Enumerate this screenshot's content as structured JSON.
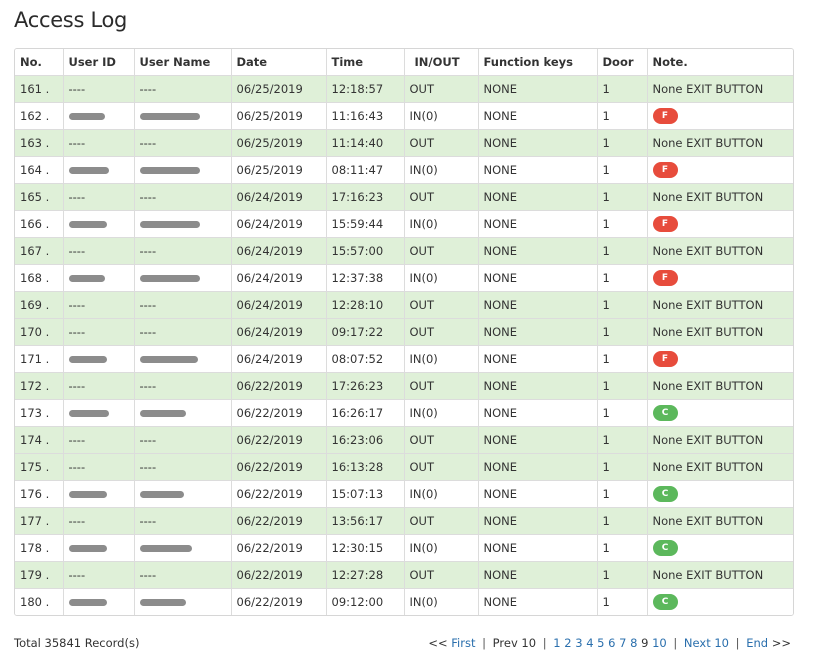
{
  "page": {
    "title": "Access Log"
  },
  "colors": {
    "exit_row_bg": "#dff0d8",
    "badge_f": "#e74c3c",
    "badge_c": "#5cb85c",
    "link": "#2a6fad"
  },
  "table": {
    "columns": [
      "No.",
      "User ID",
      "User Name",
      "Date",
      "Time",
      "IN/OUT",
      "Function keys",
      "Door",
      "Note."
    ],
    "rows": [
      {
        "no": "161 .",
        "user_id": "----",
        "user_name": "----",
        "date": "06/25/2019",
        "time": "12:18:57",
        "inout": "OUT",
        "fkey": "NONE",
        "door": "1",
        "note": "None EXIT BUTTON",
        "badge": ""
      },
      {
        "no": "162 .",
        "user_id": "",
        "user_name": "",
        "date": "06/25/2019",
        "time": "11:16:43",
        "inout": "IN(0)",
        "fkey": "NONE",
        "door": "1",
        "note": "",
        "badge": "F"
      },
      {
        "no": "163 .",
        "user_id": "----",
        "user_name": "----",
        "date": "06/25/2019",
        "time": "11:14:40",
        "inout": "OUT",
        "fkey": "NONE",
        "door": "1",
        "note": "None EXIT BUTTON",
        "badge": ""
      },
      {
        "no": "164 .",
        "user_id": "",
        "user_name": "",
        "date": "06/25/2019",
        "time": "08:11:47",
        "inout": "IN(0)",
        "fkey": "NONE",
        "door": "1",
        "note": "",
        "badge": "F"
      },
      {
        "no": "165 .",
        "user_id": "----",
        "user_name": "----",
        "date": "06/24/2019",
        "time": "17:16:23",
        "inout": "OUT",
        "fkey": "NONE",
        "door": "1",
        "note": "None EXIT BUTTON",
        "badge": ""
      },
      {
        "no": "166 .",
        "user_id": "",
        "user_name": "",
        "date": "06/24/2019",
        "time": "15:59:44",
        "inout": "IN(0)",
        "fkey": "NONE",
        "door": "1",
        "note": "",
        "badge": "F"
      },
      {
        "no": "167 .",
        "user_id": "----",
        "user_name": "----",
        "date": "06/24/2019",
        "time": "15:57:00",
        "inout": "OUT",
        "fkey": "NONE",
        "door": "1",
        "note": "None EXIT BUTTON",
        "badge": ""
      },
      {
        "no": "168 .",
        "user_id": "",
        "user_name": "",
        "date": "06/24/2019",
        "time": "12:37:38",
        "inout": "IN(0)",
        "fkey": "NONE",
        "door": "1",
        "note": "",
        "badge": "F"
      },
      {
        "no": "169 .",
        "user_id": "----",
        "user_name": "----",
        "date": "06/24/2019",
        "time": "12:28:10",
        "inout": "OUT",
        "fkey": "NONE",
        "door": "1",
        "note": "None EXIT BUTTON",
        "badge": ""
      },
      {
        "no": "170 .",
        "user_id": "----",
        "user_name": "----",
        "date": "06/24/2019",
        "time": "09:17:22",
        "inout": "OUT",
        "fkey": "NONE",
        "door": "1",
        "note": "None EXIT BUTTON",
        "badge": ""
      },
      {
        "no": "171 .",
        "user_id": "",
        "user_name": "",
        "date": "06/24/2019",
        "time": "08:07:52",
        "inout": "IN(0)",
        "fkey": "NONE",
        "door": "1",
        "note": "",
        "badge": "F"
      },
      {
        "no": "172 .",
        "user_id": "----",
        "user_name": "----",
        "date": "06/22/2019",
        "time": "17:26:23",
        "inout": "OUT",
        "fkey": "NONE",
        "door": "1",
        "note": "None EXIT BUTTON",
        "badge": ""
      },
      {
        "no": "173 .",
        "user_id": "",
        "user_name": "",
        "date": "06/22/2019",
        "time": "16:26:17",
        "inout": "IN(0)",
        "fkey": "NONE",
        "door": "1",
        "note": "",
        "badge": "C"
      },
      {
        "no": "174 .",
        "user_id": "----",
        "user_name": "----",
        "date": "06/22/2019",
        "time": "16:23:06",
        "inout": "OUT",
        "fkey": "NONE",
        "door": "1",
        "note": "None EXIT BUTTON",
        "badge": ""
      },
      {
        "no": "175 .",
        "user_id": "----",
        "user_name": "----",
        "date": "06/22/2019",
        "time": "16:13:28",
        "inout": "OUT",
        "fkey": "NONE",
        "door": "1",
        "note": "None EXIT BUTTON",
        "badge": ""
      },
      {
        "no": "176 .",
        "user_id": "",
        "user_name": "",
        "date": "06/22/2019",
        "time": "15:07:13",
        "inout": "IN(0)",
        "fkey": "NONE",
        "door": "1",
        "note": "",
        "badge": "C"
      },
      {
        "no": "177 .",
        "user_id": "----",
        "user_name": "----",
        "date": "06/22/2019",
        "time": "13:56:17",
        "inout": "OUT",
        "fkey": "NONE",
        "door": "1",
        "note": "None EXIT BUTTON",
        "badge": ""
      },
      {
        "no": "178 .",
        "user_id": "",
        "user_name": "",
        "date": "06/22/2019",
        "time": "12:30:15",
        "inout": "IN(0)",
        "fkey": "NONE",
        "door": "1",
        "note": "",
        "badge": "C"
      },
      {
        "no": "179 .",
        "user_id": "----",
        "user_name": "----",
        "date": "06/22/2019",
        "time": "12:27:28",
        "inout": "OUT",
        "fkey": "NONE",
        "door": "1",
        "note": "None EXIT BUTTON",
        "badge": ""
      },
      {
        "no": "180 .",
        "user_id": "",
        "user_name": "",
        "date": "06/22/2019",
        "time": "09:12:00",
        "inout": "IN(0)",
        "fkey": "NONE",
        "door": "1",
        "note": "",
        "badge": "C"
      }
    ]
  },
  "footer": {
    "total": "Total 35841 Record(s)",
    "pager": {
      "first_prefix": "<<",
      "first": "First",
      "prev": "Prev 10",
      "pages": [
        "1",
        "2",
        "3",
        "4",
        "5",
        "6",
        "7",
        "8",
        "9",
        "10"
      ],
      "current": "9",
      "next": "Next 10",
      "end": "End",
      "end_suffix": ">>"
    }
  }
}
